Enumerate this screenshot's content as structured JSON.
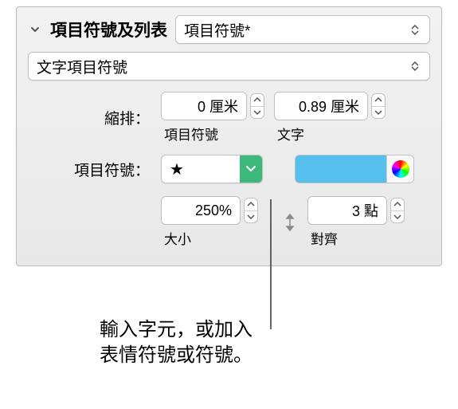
{
  "section_title": "項目符號及列表",
  "style_select": "項目符號*",
  "type_select": "文字項目符號",
  "indent": {
    "label": "縮排：",
    "bullet_value": "0 厘米",
    "bullet_sublabel": "項目符號",
    "text_value": "0.89 厘米",
    "text_sublabel": "文字"
  },
  "bullet_symbol": {
    "label": "項目符號：",
    "glyph": "★",
    "color": "#55c0ee"
  },
  "size": {
    "value": "250%",
    "sublabel": "大小"
  },
  "align": {
    "value": "3 點",
    "sublabel": "對齊"
  },
  "annotation": {
    "line1": "輸入字元，或加入",
    "line2": "表情符號或符號。"
  }
}
